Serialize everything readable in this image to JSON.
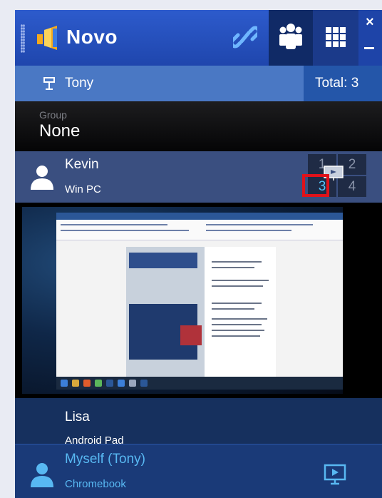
{
  "header": {
    "app_name": "Novo",
    "close_glyph": "×",
    "icons": [
      "link-icon",
      "people-icon",
      "grid-icon",
      "close-icon",
      "minimize-icon"
    ]
  },
  "presenter": {
    "name": "Tony",
    "total": "Total: 3"
  },
  "group": {
    "label": "Group",
    "value": "None"
  },
  "users": [
    {
      "name": "Kevin",
      "device": "Win PC"
    },
    {
      "name": "Lisa",
      "device": "Android Pad"
    },
    {
      "name": "Myself (Tony)",
      "device": "Chromebook"
    }
  ],
  "split_screen": {
    "cells": [
      "1",
      "2",
      "3",
      "4"
    ],
    "selected": "3"
  },
  "colors": {
    "accent": "#2d5bcc",
    "highlight": "#e0121a",
    "self_text": "#58b8f2"
  }
}
